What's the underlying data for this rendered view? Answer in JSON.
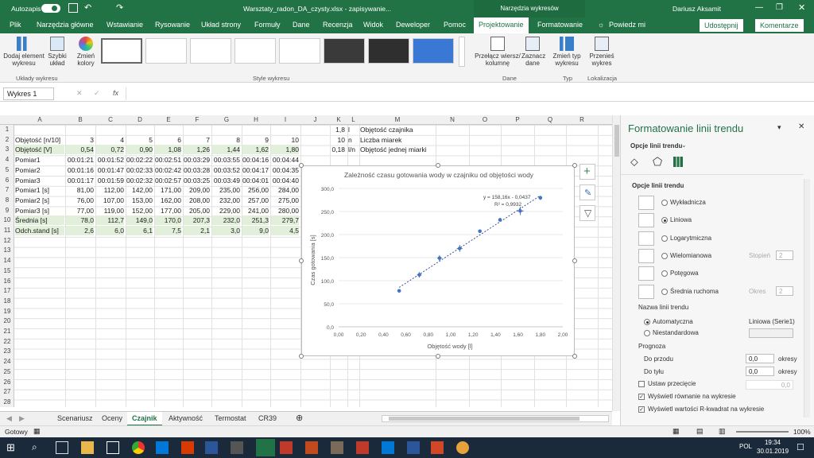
{
  "titlebar": {
    "autosave": "Autozapis",
    "filename": "Warsztaty_radon_DA_czysty.xlsx - zapisywanie...",
    "charttools": "Narzędzia wykresów",
    "user": "Dariusz Aksamit"
  },
  "tabs": [
    "Plik",
    "Narzędzia główne",
    "Wstawianie",
    "Rysowanie",
    "Układ strony",
    "Formuły",
    "Dane",
    "Recenzja",
    "Widok",
    "Deweloper",
    "Pomoc",
    "Projektowanie",
    "Formatowanie",
    "Powiedz mi"
  ],
  "share": "Udostępnij",
  "comments": "Komentarze",
  "ribbon": {
    "add_element": "Dodaj element wykresu",
    "quick_layout": "Szybki układ",
    "change_colors": "Zmień kolory",
    "switch_rowcol": "Przełącz wiersz/ kolumnę",
    "select_data": "Zaznacz dane",
    "change_type": "Zmień typ wykresu",
    "move_chart": "Przenieś wykres",
    "grp_layouts": "Układy wykresu",
    "grp_styles": "Style wykresu",
    "grp_data": "Dane",
    "grp_type": "Typ",
    "grp_location": "Lokalizacja"
  },
  "namebox": "Wykres 1",
  "fx": "fx",
  "columns": [
    "A",
    "B",
    "C",
    "D",
    "E",
    "F",
    "G",
    "H",
    "I",
    "J",
    "K",
    "L",
    "M",
    "N",
    "O",
    "P",
    "Q",
    "R"
  ],
  "rows": [
    "1",
    "2",
    "3",
    "4",
    "5",
    "6",
    "7",
    "8",
    "9",
    "10",
    "11",
    "12",
    "13",
    "14",
    "15",
    "16",
    "17",
    "18",
    "19",
    "20",
    "21",
    "22",
    "23",
    "24",
    "25",
    "26",
    "27",
    "28"
  ],
  "table": {
    "labels": [
      "Objętość [n/10]",
      "Objętość [V]",
      "Pomiar1",
      "Pomiar2",
      "Pomiar3",
      "Pomiar1 [s]",
      "Pomiar2 [s]",
      "Pomiar3 [s]",
      "Średnia [s]",
      "Odch.stand [s]"
    ],
    "rows": [
      [
        "3",
        "4",
        "5",
        "6",
        "7",
        "8",
        "9",
        "10"
      ],
      [
        "0,54",
        "0,72",
        "0,90",
        "1,08",
        "1,26",
        "1,44",
        "1,62",
        "1,80"
      ],
      [
        "00:01:21",
        "00:01:52",
        "00:02:22",
        "00:02:51",
        "00:03:29",
        "00:03:55",
        "00:04:16",
        "00:04:44"
      ],
      [
        "00:01:16",
        "00:01:47",
        "00:02:33",
        "00:02:42",
        "00:03:28",
        "00:03:52",
        "00:04:17",
        "00:04:35"
      ],
      [
        "00:01:17",
        "00:01:59",
        "00:02:32",
        "00:02:57",
        "00:03:25",
        "00:03:49",
        "00:04:01",
        "00:04:40"
      ],
      [
        "81,00",
        "112,00",
        "142,00",
        "171,00",
        "209,00",
        "235,00",
        "256,00",
        "284,00"
      ],
      [
        "76,00",
        "107,00",
        "153,00",
        "162,00",
        "208,00",
        "232,00",
        "257,00",
        "275,00"
      ],
      [
        "77,00",
        "119,00",
        "152,00",
        "177,00",
        "205,00",
        "229,00",
        "241,00",
        "280,00"
      ],
      [
        "78,0",
        "112,7",
        "149,0",
        "170,0",
        "207,3",
        "232,0",
        "251,3",
        "279,7"
      ],
      [
        "2,6",
        "6,0",
        "6,1",
        "7,5",
        "2,1",
        "3,0",
        "9,0",
        "4,5"
      ]
    ],
    "params": [
      [
        "1,8",
        "l",
        "Objętość czajnika"
      ],
      [
        "10",
        "n",
        "Liczba miarek"
      ],
      [
        "0,18",
        "l/n",
        "Objętość jednej miarki"
      ]
    ]
  },
  "chart_data": {
    "type": "scatter",
    "title": "Zależność czasu gotowania wody w czajniku od objętości wody",
    "xlabel": "Objętość wody [l]",
    "ylabel": "Czas gotowania [s]",
    "xlim": [
      0,
      2
    ],
    "ylim": [
      0,
      300
    ],
    "xticks": [
      "0,00",
      "0,20",
      "0,40",
      "0,60",
      "0,80",
      "1,00",
      "1,20",
      "1,40",
      "1,60",
      "1,80",
      "2,00"
    ],
    "yticks": [
      "0,0",
      "50,0",
      "100,0",
      "150,0",
      "200,0",
      "250,0",
      "300,0"
    ],
    "x": [
      0.54,
      0.72,
      0.9,
      1.08,
      1.26,
      1.44,
      1.62,
      1.8
    ],
    "y": [
      78.0,
      112.7,
      149.0,
      170.0,
      207.3,
      232.0,
      251.3,
      279.7
    ],
    "yerr": [
      2.6,
      6.0,
      6.1,
      7.5,
      2.1,
      3.0,
      9.0,
      4.5
    ],
    "trend": {
      "slope": 158.16,
      "intercept": -0.0437,
      "equation": "y = 158,16x - 0,0437",
      "r2": "R² = 0,9932"
    },
    "grid": true
  },
  "sheets": [
    "Scenariusz",
    "Oceny",
    "Czajnik",
    "Aktywność",
    "Termostat",
    "CR39"
  ],
  "status": {
    "ready": "Gotowy",
    "zoom": "100%"
  },
  "taskbar": {
    "time": "19:34",
    "date": "30.01.2019",
    "lang": "POL"
  },
  "pane": {
    "title": "Formatowanie linii trendu",
    "subtitle": "Opcje linii trendu",
    "section": "Opcje linii trendu",
    "types": [
      "Wykładnicza",
      "Liniowa",
      "Logarytmiczna",
      "Wielomianowa",
      "Potęgowa",
      "Średnia ruchoma"
    ],
    "degree_label": "Stopień",
    "degree": "2",
    "period_label": "Okres",
    "period": "2",
    "name_label": "Nazwa linii trendu",
    "auto": "Automatyczna",
    "auto_value": "Liniowa (Serie1)",
    "custom": "Niestandardowa",
    "forecast": "Prognoza",
    "forward": "Do przodu",
    "backward": "Do tyłu",
    "forward_val": "0,0",
    "backward_val": "0,0",
    "periods": "okresy",
    "intercept": "Ustaw przecięcie",
    "intercept_val": "0,0",
    "show_eq": "Wyświetl równanie na wykresie",
    "show_r2": "Wyświetl wartości R-kwadrat na wykresie"
  }
}
